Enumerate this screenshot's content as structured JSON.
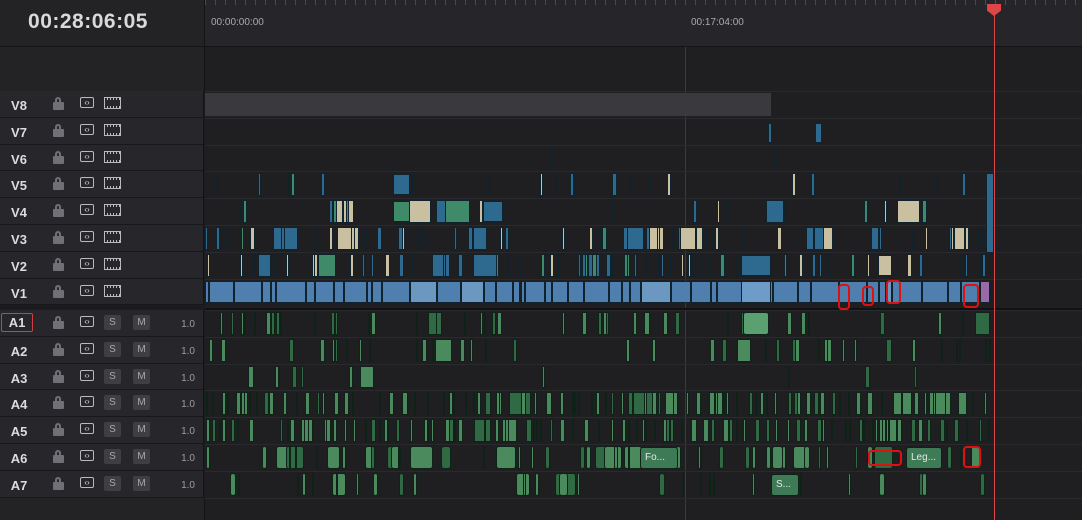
{
  "timecode": "00:28:06:05",
  "ruler": {
    "labels": [
      "00:00:00:00",
      "00:17:04:00"
    ]
  },
  "video_tracks": [
    {
      "name": "V8"
    },
    {
      "name": "V7"
    },
    {
      "name": "V6"
    },
    {
      "name": "V5"
    },
    {
      "name": "V4"
    },
    {
      "name": "V3"
    },
    {
      "name": "V2"
    },
    {
      "name": "V1"
    }
  ],
  "audio_tracks": [
    {
      "name": "A1",
      "volume": "1.0",
      "solo": "S",
      "mute": "M"
    },
    {
      "name": "A2",
      "volume": "1.0",
      "solo": "S",
      "mute": "M"
    },
    {
      "name": "A3",
      "volume": "1.0",
      "solo": "S",
      "mute": "M"
    },
    {
      "name": "A4",
      "volume": "1.0",
      "solo": "S",
      "mute": "M"
    },
    {
      "name": "A5",
      "volume": "1.0",
      "solo": "S",
      "mute": "M"
    },
    {
      "name": "A6",
      "volume": "1.0",
      "solo": "S",
      "mute": "M"
    },
    {
      "name": "A7",
      "volume": "1.0",
      "solo": "S",
      "mute": "M"
    }
  ],
  "clip_labels": {
    "a6_fo": "Fo...",
    "a6_leg": "Leg...",
    "a7_s": "S..."
  },
  "icons": {
    "lock": "lock-icon",
    "autoselect": "auto-select-icon",
    "video_enable": "film-icon"
  },
  "colors": {
    "video_blue": "#2e6a8f",
    "video_tan": "#c8c0a0",
    "video_green": "#3f8a68",
    "v1_blue": "#4f7fae",
    "audio_green": "#4a8a5c",
    "playhead": "#e04545",
    "annotation": "#e01010"
  }
}
